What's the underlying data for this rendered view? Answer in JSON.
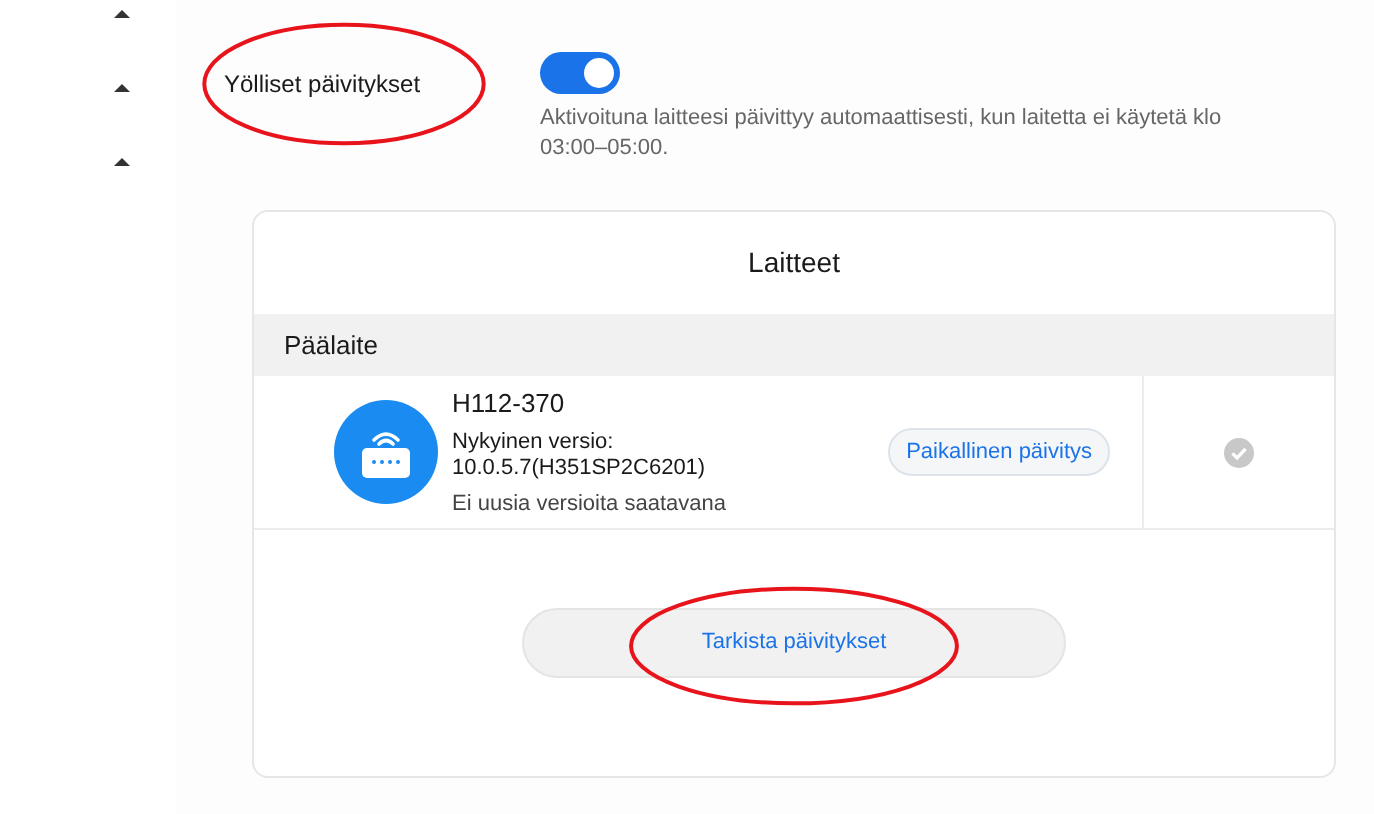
{
  "sidebar": {
    "items": [
      {
        "expanded": true
      },
      {
        "expanded": true
      },
      {
        "expanded": true
      }
    ]
  },
  "nightly_updates": {
    "label": "Yölliset päivitykset",
    "circled": true,
    "on": true,
    "description": "Aktivoituna laitteesi päivittyy automaattisesti, kun laitetta ei käytetä klo 03:00–05:00."
  },
  "devices": {
    "title": "Laitteet",
    "section": "Päälaite",
    "rows": [
      {
        "name": "H112-370",
        "version_label": "Nykyinen versio:",
        "version": "10.0.5.7(H351SP2C6201)",
        "status": "Ei uusia versioita saatavana",
        "action": "Paikallinen päivitys",
        "selected": false
      }
    ],
    "check_button": {
      "label": "Tarkista päivitykset",
      "circled": true
    }
  }
}
